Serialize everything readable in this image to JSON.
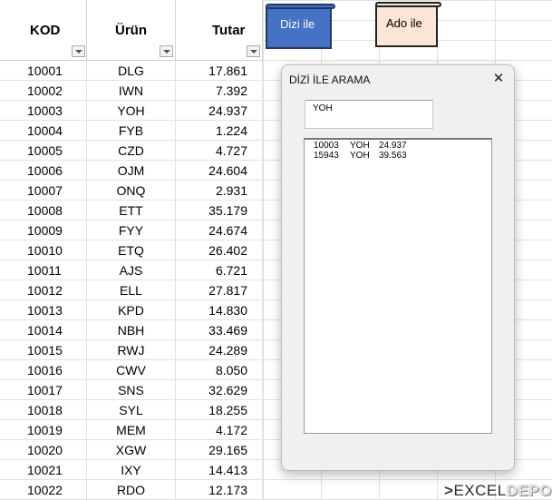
{
  "sheet": {
    "headers": {
      "kod": "KOD",
      "urun": "Ürün",
      "tutar": "Tutar"
    },
    "rows": [
      {
        "kod": "10001",
        "urun": "DLG",
        "tutar": "17.861"
      },
      {
        "kod": "10002",
        "urun": "IWN",
        "tutar": "7.392"
      },
      {
        "kod": "10003",
        "urun": "YOH",
        "tutar": "24.937"
      },
      {
        "kod": "10004",
        "urun": "FYB",
        "tutar": "1.224"
      },
      {
        "kod": "10005",
        "urun": "CZD",
        "tutar": "4.727"
      },
      {
        "kod": "10006",
        "urun": "OJM",
        "tutar": "24.604"
      },
      {
        "kod": "10007",
        "urun": "ONQ",
        "tutar": "2.931"
      },
      {
        "kod": "10008",
        "urun": "ETT",
        "tutar": "35.179"
      },
      {
        "kod": "10009",
        "urun": "FYY",
        "tutar": "24.674"
      },
      {
        "kod": "10010",
        "urun": "ETQ",
        "tutar": "26.402"
      },
      {
        "kod": "10011",
        "urun": "AJS",
        "tutar": "6.721"
      },
      {
        "kod": "10012",
        "urun": "ELL",
        "tutar": "27.817"
      },
      {
        "kod": "10013",
        "urun": "KPD",
        "tutar": "14.830"
      },
      {
        "kod": "10014",
        "urun": "NBH",
        "tutar": "33.469"
      },
      {
        "kod": "10015",
        "urun": "RWJ",
        "tutar": "24.289"
      },
      {
        "kod": "10016",
        "urun": "CWV",
        "tutar": "8.050"
      },
      {
        "kod": "10017",
        "urun": "SNS",
        "tutar": "32.629"
      },
      {
        "kod": "10018",
        "urun": "SYL",
        "tutar": "18.255"
      },
      {
        "kod": "10019",
        "urun": "MEM",
        "tutar": "4.172"
      },
      {
        "kod": "10020",
        "urun": "XGW",
        "tutar": "29.165"
      },
      {
        "kod": "10021",
        "urun": "IXY",
        "tutar": "14.413"
      },
      {
        "kod": "10022",
        "urun": "RDO",
        "tutar": "12.173"
      }
    ]
  },
  "shapes": {
    "dizi_label": "Dizi ile",
    "dizi_color": "#4472c4",
    "ado_label": "Ado ile",
    "ado_color": "#fbe5d6"
  },
  "dialog": {
    "title": "DİZİ İLE ARAMA",
    "close_glyph": "✕",
    "search_value": "YOH",
    "results": [
      {
        "kod": "10003",
        "urun": "YOH",
        "tutar": "24.937"
      },
      {
        "kod": "15943",
        "urun": "YOH",
        "tutar": "39.563"
      }
    ]
  },
  "logo": {
    "part1": "EXCEL",
    "part2": "DEPO"
  }
}
